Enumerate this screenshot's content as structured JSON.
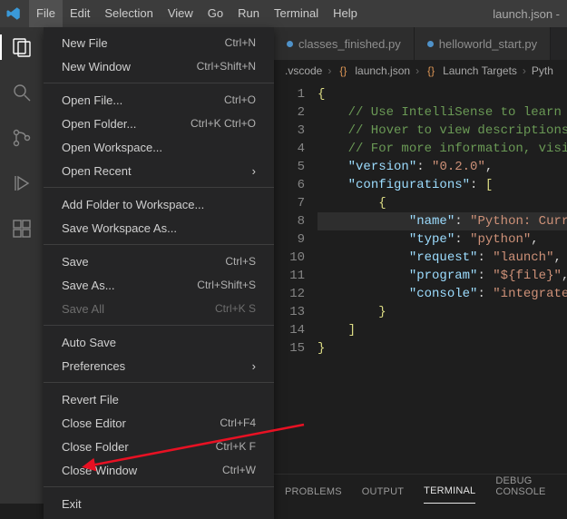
{
  "window": {
    "title": "launch.json -"
  },
  "menubar": {
    "items": [
      "File",
      "Edit",
      "Selection",
      "View",
      "Go",
      "Run",
      "Terminal",
      "Help"
    ],
    "active_index": 0
  },
  "activitybar": {
    "icons": [
      "explorer",
      "search",
      "scm",
      "debug",
      "extensions"
    ],
    "active_index": 0
  },
  "file_menu": {
    "groups": [
      [
        {
          "label": "New File",
          "accel": "Ctrl+N"
        },
        {
          "label": "New Window",
          "accel": "Ctrl+Shift+N"
        }
      ],
      [
        {
          "label": "Open File...",
          "accel": "Ctrl+O"
        },
        {
          "label": "Open Folder...",
          "accel": "Ctrl+K Ctrl+O"
        },
        {
          "label": "Open Workspace..."
        },
        {
          "label": "Open Recent",
          "submenu": true
        }
      ],
      [
        {
          "label": "Add Folder to Workspace..."
        },
        {
          "label": "Save Workspace As..."
        }
      ],
      [
        {
          "label": "Save",
          "accel": "Ctrl+S"
        },
        {
          "label": "Save As...",
          "accel": "Ctrl+Shift+S"
        },
        {
          "label": "Save All",
          "accel": "Ctrl+K S",
          "disabled": true
        }
      ],
      [
        {
          "label": "Auto Save"
        },
        {
          "label": "Preferences",
          "submenu": true
        }
      ],
      [
        {
          "label": "Revert File"
        },
        {
          "label": "Close Editor",
          "accel": "Ctrl+F4"
        },
        {
          "label": "Close Folder",
          "accel": "Ctrl+K F"
        },
        {
          "label": "Close Window",
          "accel": "Ctrl+W"
        }
      ],
      [
        {
          "label": "Exit"
        }
      ]
    ]
  },
  "tabs": [
    {
      "label": "classes_finished.py",
      "lang": "py",
      "active": false
    },
    {
      "label": "helloworld_start.py",
      "lang": "py",
      "active": false
    }
  ],
  "breadcrumbs": {
    "segments": [
      ".vscode",
      "launch.json",
      "Launch Targets",
      "Pyth"
    ],
    "json_icon": "{}"
  },
  "editor": {
    "lines": [
      {
        "n": 1,
        "tokens": [
          [
            "br",
            "{"
          ]
        ]
      },
      {
        "n": 2,
        "tokens": [
          [
            "cm",
            "    // Use IntelliSense to learn "
          ]
        ]
      },
      {
        "n": 3,
        "tokens": [
          [
            "cm",
            "    // Hover to view descriptions"
          ]
        ]
      },
      {
        "n": 4,
        "tokens": [
          [
            "cm",
            "    // For more information, visi"
          ]
        ]
      },
      {
        "n": 5,
        "tokens": [
          [
            "pn",
            "    "
          ],
          [
            "key",
            "\"version\""
          ],
          [
            "pn",
            ": "
          ],
          [
            "str",
            "\"0.2.0\""
          ],
          [
            "pn",
            ","
          ]
        ]
      },
      {
        "n": 6,
        "tokens": [
          [
            "pn",
            "    "
          ],
          [
            "key",
            "\"configurations\""
          ],
          [
            "pn",
            ": "
          ],
          [
            "br",
            "["
          ]
        ]
      },
      {
        "n": 7,
        "tokens": [
          [
            "pn",
            "        "
          ],
          [
            "br",
            "{"
          ]
        ]
      },
      {
        "n": 8,
        "hl": true,
        "tokens": [
          [
            "pn",
            "            "
          ],
          [
            "key",
            "\"name\""
          ],
          [
            "pn",
            ": "
          ],
          [
            "str",
            "\"Python: Curr"
          ]
        ]
      },
      {
        "n": 9,
        "tokens": [
          [
            "pn",
            "            "
          ],
          [
            "key",
            "\"type\""
          ],
          [
            "pn",
            ": "
          ],
          [
            "str",
            "\"python\""
          ],
          [
            "pn",
            ","
          ]
        ]
      },
      {
        "n": 10,
        "tokens": [
          [
            "pn",
            "            "
          ],
          [
            "key",
            "\"request\""
          ],
          [
            "pn",
            ": "
          ],
          [
            "str",
            "\"launch\""
          ],
          [
            "pn",
            ","
          ]
        ]
      },
      {
        "n": 11,
        "tokens": [
          [
            "pn",
            "            "
          ],
          [
            "key",
            "\"program\""
          ],
          [
            "pn",
            ": "
          ],
          [
            "str",
            "\"${file}\""
          ],
          [
            "pn",
            ","
          ]
        ]
      },
      {
        "n": 12,
        "tokens": [
          [
            "pn",
            "            "
          ],
          [
            "key",
            "\"console\""
          ],
          [
            "pn",
            ": "
          ],
          [
            "str",
            "\"integrate"
          ]
        ]
      },
      {
        "n": 13,
        "tokens": [
          [
            "pn",
            "        "
          ],
          [
            "br",
            "}"
          ]
        ]
      },
      {
        "n": 14,
        "tokens": [
          [
            "pn",
            "    "
          ],
          [
            "br",
            "]"
          ]
        ]
      },
      {
        "n": 15,
        "tokens": [
          [
            "br",
            "}"
          ]
        ]
      }
    ]
  },
  "panel": {
    "tabs": [
      "PROBLEMS",
      "OUTPUT",
      "TERMINAL",
      "DEBUG CONSOLE"
    ],
    "active_index": 2
  }
}
